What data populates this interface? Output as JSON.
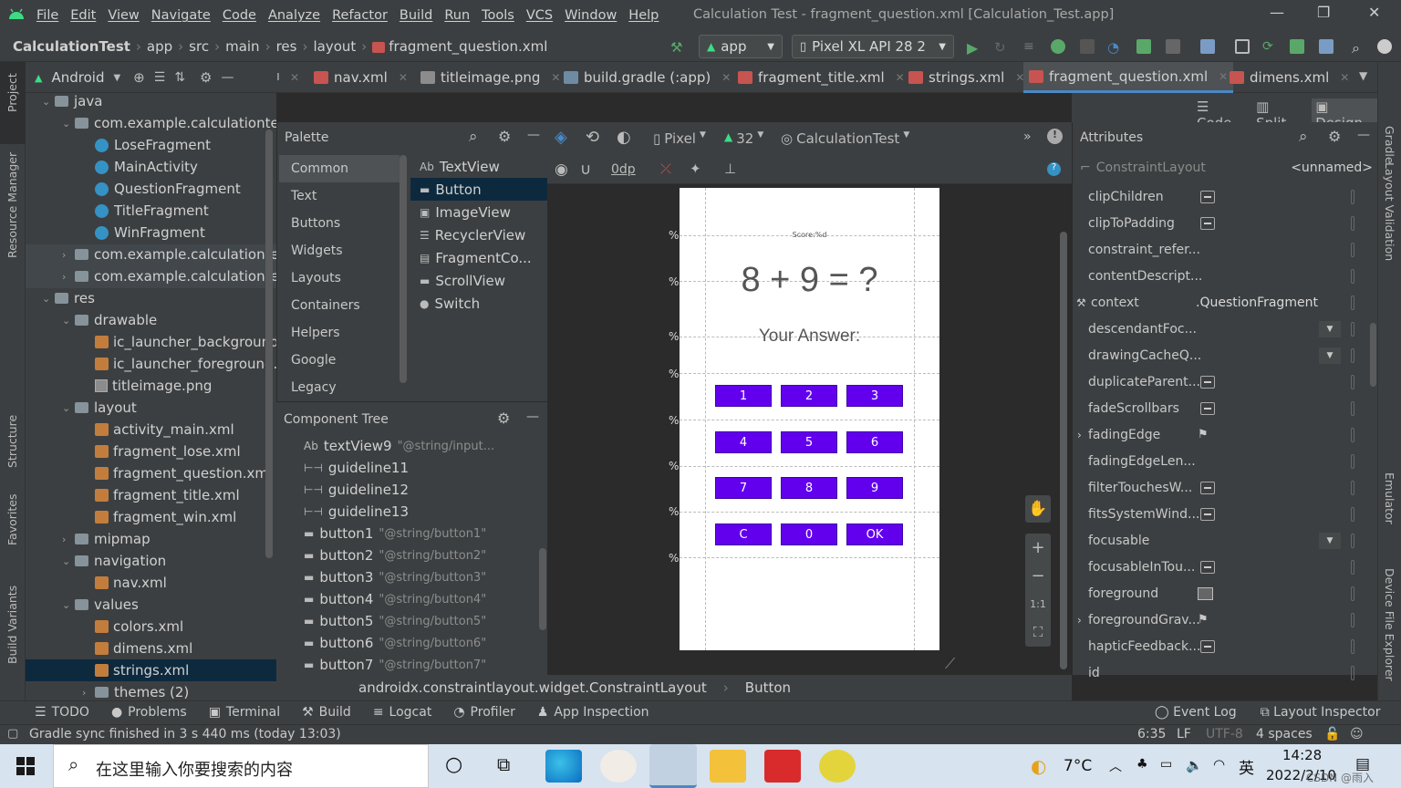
{
  "menu": {
    "items": [
      "File",
      "Edit",
      "View",
      "Navigate",
      "Code",
      "Analyze",
      "Refactor",
      "Build",
      "Run",
      "Tools",
      "VCS",
      "Window",
      "Help"
    ],
    "window_title": "Calculation Test - fragment_question.xml [Calculation_Test.app]"
  },
  "nav": {
    "breadcrumbs": [
      "CalculationTest",
      "app",
      "src",
      "main",
      "res",
      "layout",
      "fragment_question.xml"
    ],
    "run_config": "app",
    "device": "Pixel XL API 28 2"
  },
  "tabs": {
    "lead": "ı",
    "items": [
      {
        "label": "nav.xml",
        "icon": "xml-icon"
      },
      {
        "label": "titleimage.png",
        "icon": "image-icon"
      },
      {
        "label": "build.gradle (:app)",
        "icon": "gradle-icon"
      },
      {
        "label": "fragment_title.xml",
        "icon": "xml-icon"
      },
      {
        "label": "strings.xml",
        "icon": "xml-icon"
      },
      {
        "label": "fragment_question.xml",
        "icon": "layout-icon",
        "active": true
      },
      {
        "label": "dimens.xml",
        "icon": "xml-icon"
      }
    ]
  },
  "left_strip": {
    "project": "Project",
    "resource_manager": "Resource Manager",
    "structure": "Structure",
    "favorites": "Favorites",
    "build_variants": "Build Variants"
  },
  "right_strip": {
    "gradle": "Gradle",
    "layout_validation": "Layout Validation",
    "emulator": "Emulator",
    "device_file_explorer": "Device File Explorer"
  },
  "project": {
    "view_mode": "Android",
    "tree": [
      {
        "label": "java",
        "depth": 1,
        "type": "folder",
        "expanded": true
      },
      {
        "label": "com.example.calculationtest",
        "depth": 2,
        "type": "folder",
        "expanded": true
      },
      {
        "label": "LoseFragment",
        "depth": 3,
        "type": "class"
      },
      {
        "label": "MainActivity",
        "depth": 3,
        "type": "class"
      },
      {
        "label": "QuestionFragment",
        "depth": 3,
        "type": "class"
      },
      {
        "label": "TitleFragment",
        "depth": 3,
        "type": "class"
      },
      {
        "label": "WinFragment",
        "depth": 3,
        "type": "class"
      },
      {
        "label": "com.example.calculationtest",
        "depth": 2,
        "type": "folder",
        "expanded": false
      },
      {
        "label": "com.example.calculationtest",
        "depth": 2,
        "type": "folder",
        "expanded": false
      },
      {
        "label": "res",
        "depth": 1,
        "type": "folder",
        "expanded": true
      },
      {
        "label": "drawable",
        "depth": 2,
        "type": "folder",
        "expanded": true
      },
      {
        "label": "ic_launcher_background.xml",
        "depth": 3,
        "type": "xml"
      },
      {
        "label": "ic_launcher_foreground.xml",
        "depth": 3,
        "type": "xml"
      },
      {
        "label": "titleimage.png",
        "depth": 3,
        "type": "png"
      },
      {
        "label": "layout",
        "depth": 2,
        "type": "folder",
        "expanded": true
      },
      {
        "label": "activity_main.xml",
        "depth": 3,
        "type": "xml"
      },
      {
        "label": "fragment_lose.xml",
        "depth": 3,
        "type": "xml"
      },
      {
        "label": "fragment_question.xml",
        "depth": 3,
        "type": "xml"
      },
      {
        "label": "fragment_title.xml",
        "depth": 3,
        "type": "xml"
      },
      {
        "label": "fragment_win.xml",
        "depth": 3,
        "type": "xml"
      },
      {
        "label": "mipmap",
        "depth": 2,
        "type": "folder",
        "expanded": false
      },
      {
        "label": "navigation",
        "depth": 2,
        "type": "folder",
        "expanded": true
      },
      {
        "label": "nav.xml",
        "depth": 3,
        "type": "xml"
      },
      {
        "label": "values",
        "depth": 2,
        "type": "folder",
        "expanded": true
      },
      {
        "label": "colors.xml",
        "depth": 3,
        "type": "xml"
      },
      {
        "label": "dimens.xml",
        "depth": 3,
        "type": "xml"
      },
      {
        "label": "strings.xml",
        "depth": 3,
        "type": "xml",
        "selected": true
      },
      {
        "label": "themes (2)",
        "depth": 3,
        "type": "folder",
        "expanded": false
      }
    ]
  },
  "palette": {
    "title": "Palette",
    "categories": [
      "Common",
      "Text",
      "Buttons",
      "Widgets",
      "Layouts",
      "Containers",
      "Helpers",
      "Google",
      "Legacy"
    ],
    "items": [
      {
        "label": "TextView",
        "prefix": "Ab"
      },
      {
        "label": "Button",
        "selected": true
      },
      {
        "label": "ImageView"
      },
      {
        "label": "RecyclerView"
      },
      {
        "label": "FragmentCo..."
      },
      {
        "label": "ScrollView"
      },
      {
        "label": "Switch"
      }
    ]
  },
  "component_tree": {
    "title": "Component Tree",
    "rows": [
      {
        "label": "textView9",
        "ref": "\"@string/input...",
        "prefix": "Ab"
      },
      {
        "label": "guideline11",
        "ref": ""
      },
      {
        "label": "guideline12",
        "ref": ""
      },
      {
        "label": "guideline13",
        "ref": ""
      },
      {
        "label": "button1",
        "ref": "\"@string/button1\""
      },
      {
        "label": "button2",
        "ref": "\"@string/button2\""
      },
      {
        "label": "button3",
        "ref": "\"@string/button3\""
      },
      {
        "label": "button4",
        "ref": "\"@string/button4\""
      },
      {
        "label": "button5",
        "ref": "\"@string/button5\""
      },
      {
        "label": "button6",
        "ref": "\"@string/button6\""
      },
      {
        "label": "button7",
        "ref": "\"@string/button7\""
      }
    ]
  },
  "design": {
    "modes": [
      "Code",
      "Split",
      "Design"
    ],
    "active_mode": "Design",
    "device": "Pixel",
    "api": "32",
    "theme": "CalculationTest",
    "margin": "0dp",
    "phone": {
      "score_text": "Score:%d",
      "question": "8 + 9 = ?",
      "answer_label": "Your Answer:",
      "keypad": [
        [
          "1",
          "2",
          "3"
        ],
        [
          "4",
          "5",
          "6"
        ],
        [
          "7",
          "8",
          "9"
        ],
        [
          "C",
          "0",
          "OK"
        ]
      ]
    },
    "zoom_controls": [
      "+",
      "−",
      "1:1"
    ]
  },
  "attributes": {
    "title": "Attributes",
    "component": "ConstraintLayout",
    "id_value": "<unnamed>",
    "rows": [
      {
        "name": "clipChildren",
        "kind": "toggle"
      },
      {
        "name": "clipToPadding",
        "kind": "toggle"
      },
      {
        "name": "constraint_refer...",
        "kind": "text"
      },
      {
        "name": "contentDescript...",
        "kind": "text"
      },
      {
        "name": "context",
        "kind": "value",
        "value": ".QuestionFragment"
      },
      {
        "name": "descendantFoc...",
        "kind": "dropdown"
      },
      {
        "name": "drawingCacheQ...",
        "kind": "dropdown"
      },
      {
        "name": "duplicateParent...",
        "kind": "toggle"
      },
      {
        "name": "fadeScrollbars",
        "kind": "toggle"
      },
      {
        "name": "fadingEdge",
        "kind": "flag",
        "expandable": true
      },
      {
        "name": "fadingEdgeLen...",
        "kind": "text"
      },
      {
        "name": "filterTouchesW...",
        "kind": "toggle"
      },
      {
        "name": "fitsSystemWind...",
        "kind": "toggle"
      },
      {
        "name": "focusable",
        "kind": "dropdown"
      },
      {
        "name": "focusableInTou...",
        "kind": "toggle"
      },
      {
        "name": "foreground",
        "kind": "image"
      },
      {
        "name": "foregroundGrav...",
        "kind": "flag",
        "expandable": true
      },
      {
        "name": "hapticFeedback...",
        "kind": "toggle"
      },
      {
        "name": "id",
        "kind": "text"
      }
    ]
  },
  "breadcrumb_bottom": [
    "androidx.constraintlayout.widget.ConstraintLayout",
    "Button"
  ],
  "bottom_tabs": [
    "TODO",
    "Problems",
    "Terminal",
    "Build",
    "Logcat",
    "Profiler",
    "App Inspection"
  ],
  "bottom_right_tabs": [
    "Event Log",
    "Layout Inspector"
  ],
  "status": {
    "message": "Gradle sync finished in 3 s 440 ms (today 13:03)",
    "position": "6:35",
    "line_sep": "LF",
    "encoding": "UTF-8",
    "indent": "4 spaces"
  },
  "taskbar": {
    "search_placeholder": "在这里输入你要搜索的内容",
    "temp": "7°C",
    "ime": "英",
    "time": "14:28",
    "date": "2022/2/10",
    "watermark": "CSDN @雨入"
  },
  "colors": {
    "accent": "#6200ee",
    "ide_bg": "#3c3f41",
    "editor_bg": "#2b2b2b",
    "selection": "#0d293e",
    "run_green": "#59a869"
  }
}
